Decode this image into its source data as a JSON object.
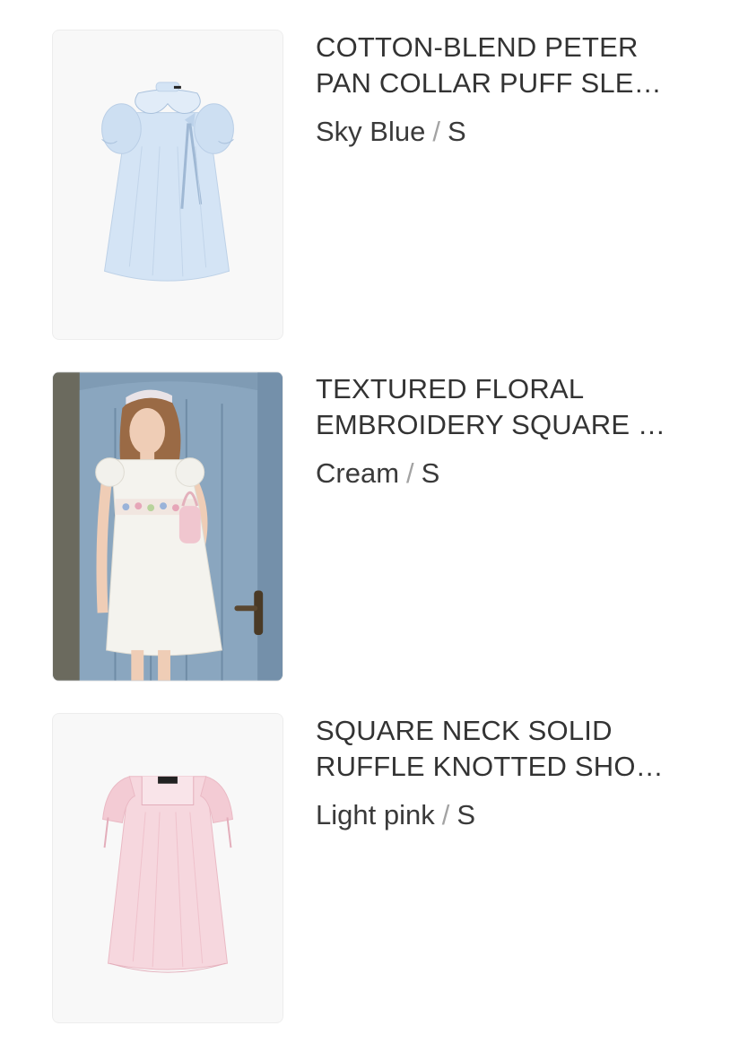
{
  "items": [
    {
      "title_line1": "COTTON-BLEND PETER",
      "title_line2": "PAN COLLAR PUFF SLE…",
      "color": "Sky Blue",
      "separator": "/",
      "size": "S",
      "image": "sky-blue-dress-image"
    },
    {
      "title_line1": "TEXTURED FLORAL",
      "title_line2": "EMBROIDERY SQUARE …",
      "color": "Cream",
      "separator": "/",
      "size": "S",
      "image": "model-cream-dress-photo"
    },
    {
      "title_line1": "SQUARE NECK SOLID",
      "title_line2": "RUFFLE KNOTTED SHO…",
      "color": "Light pink",
      "separator": "/",
      "size": "S",
      "image": "light-pink-dress-image"
    }
  ],
  "colors": {
    "sky_blue_dress": "#cfe0f3",
    "cream_dress": "#f4f3ee",
    "light_pink_dress": "#f6d7de",
    "door_blue": "#7f9bb4",
    "text": "#333333",
    "separator": "#a3a3a3"
  }
}
